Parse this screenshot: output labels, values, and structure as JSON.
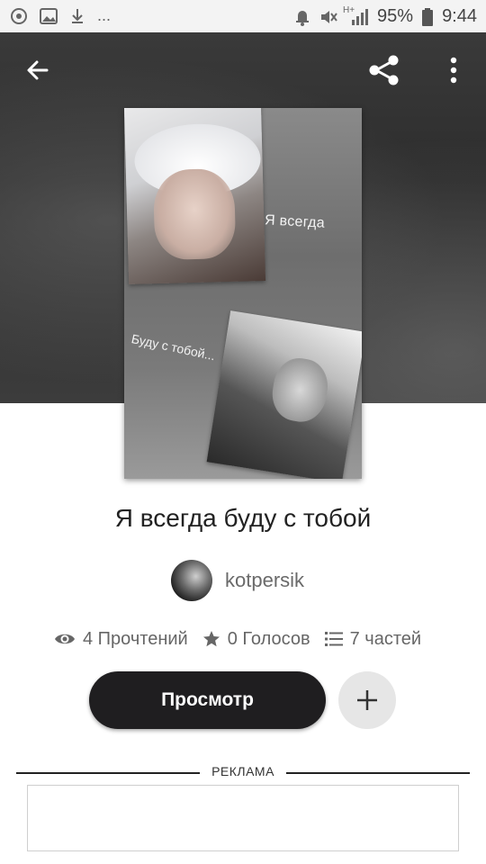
{
  "status_bar": {
    "left_icons": [
      "notification-app-icon",
      "image-icon",
      "download-icon",
      "more-notifications-icon"
    ],
    "more_notifications": "...",
    "right_icons": [
      "alarm-icon",
      "mute-icon",
      "signal-icon"
    ],
    "network_type": "H+",
    "battery_percent": "95%",
    "time": "9:44"
  },
  "toolbar": {
    "back_icon": "arrow-left-icon",
    "share_icon": "share-icon",
    "more_icon": "more-vertical-icon"
  },
  "cover": {
    "text_line1": "Я всегда",
    "text_line2": "Буду с тобой..."
  },
  "story": {
    "title": "Я всегда буду с тобой",
    "author": "kotpersik"
  },
  "stats": {
    "reads": "4 Прочтений",
    "votes": "0 Голосов",
    "parts": "7 частей"
  },
  "actions": {
    "read_label": "Просмотр",
    "add_icon": "plus-icon"
  },
  "ad": {
    "label": "РЕКЛАМА"
  }
}
